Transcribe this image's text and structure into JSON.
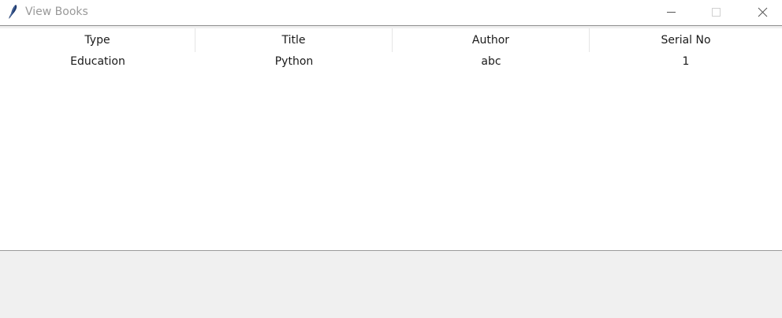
{
  "window": {
    "title": "View Books",
    "icon": "feather-icon"
  },
  "table": {
    "headers": [
      "Type",
      "Title",
      "Author",
      "Serial No"
    ],
    "rows": [
      [
        "Education",
        "Python",
        "abc",
        "1"
      ]
    ]
  }
}
